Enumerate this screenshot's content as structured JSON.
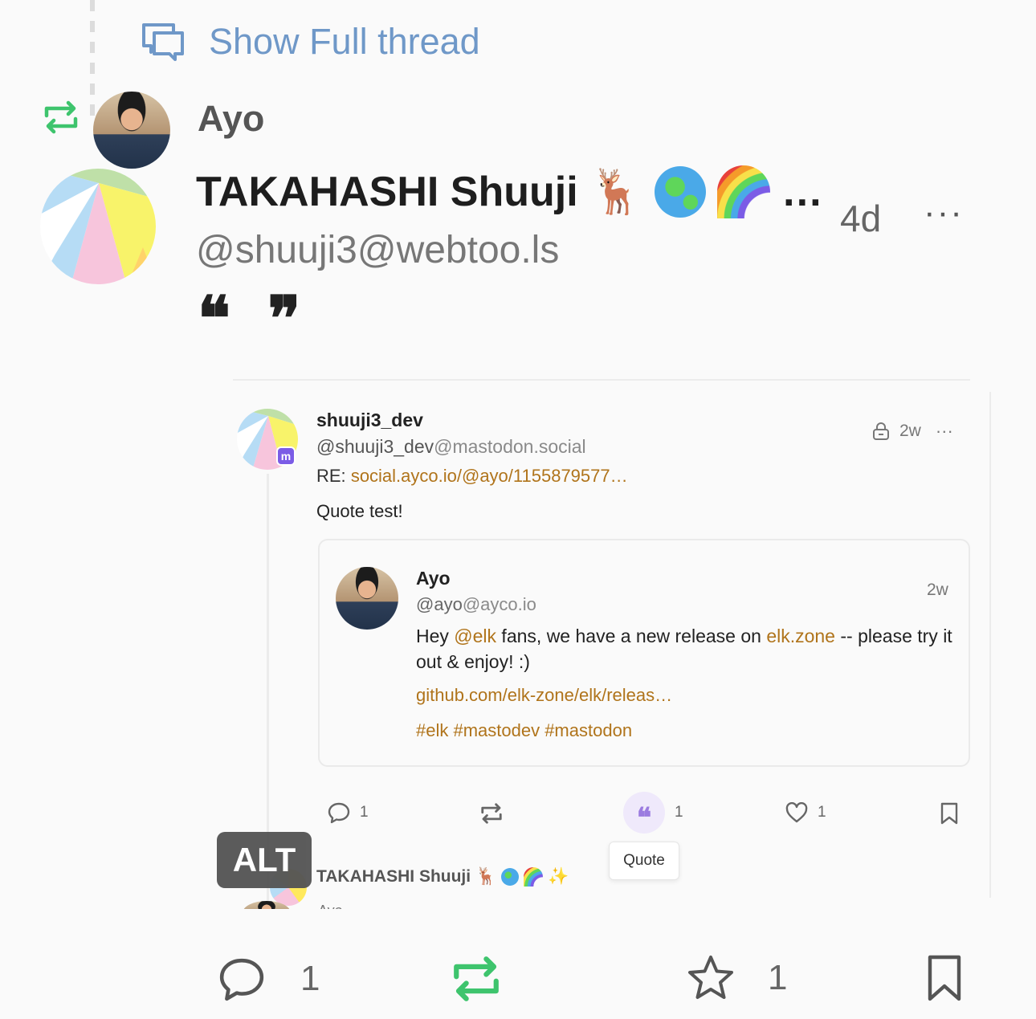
{
  "thread": {
    "show_full_label": "Show Full thread"
  },
  "boost": {
    "booster_name": "Ayo"
  },
  "status": {
    "display_name": "TAKAHASHI Shuuji",
    "name_overflow": "…",
    "handle": "@shuuji3@webtoo.ls",
    "time": "4d",
    "more": "···",
    "content_glyphs": "❝ ❞"
  },
  "quoted": {
    "display_name": "shuuji3_dev",
    "handle_user": "@shuuji3_dev",
    "handle_domain": "@mastodon.social",
    "visibility_icon": "lock-icon",
    "time": "2w",
    "more": "···",
    "re_label": "RE:",
    "re_link": "social.ayco.io/@ayo/1155879577…",
    "text": "Quote test!",
    "inner": {
      "display_name": "Ayo",
      "handle_user": "@ayo",
      "handle_domain": "@ayco.io",
      "time": "2w",
      "body_pre": "Hey ",
      "mention": "@elk",
      "body_mid": " fans, we have a new release on ",
      "site_link": "elk.zone",
      "body_post": " -- please try it out & enjoy! :)",
      "release_link": "github.com/elk-zone/elk/releas…",
      "tags": "#elk #mastodev #mastodon"
    },
    "actions": {
      "reply_count": "1",
      "quote_count": "1",
      "favorite_count": "1",
      "quote_tooltip": "Quote"
    }
  },
  "next": {
    "alt_badge": "ALT",
    "display_name": "TAKAHASHI Shuuji",
    "preview": "Ayo"
  },
  "bottom_actions": {
    "reply_count": "1",
    "favorite_count": "1"
  },
  "colors": {
    "accent_link": "#b0741b",
    "boost_active": "#3ec46d",
    "thread_link": "#6f98c8",
    "quote_purple": "#9b7be0"
  }
}
